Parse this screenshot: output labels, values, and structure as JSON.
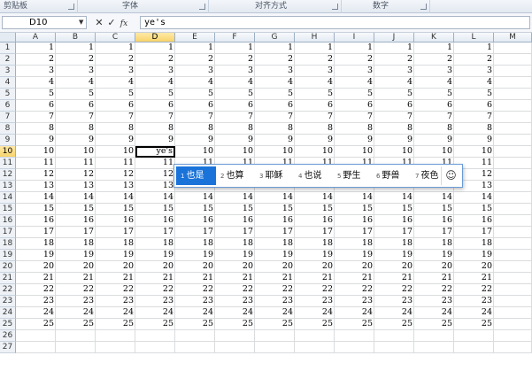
{
  "ribbon": {
    "groups": [
      {
        "label": "剪贴板"
      },
      {
        "label": "字体"
      },
      {
        "label": "对齐方式"
      },
      {
        "label": "数字"
      }
    ]
  },
  "formula_bar": {
    "name_box": "D10",
    "cancel_icon": "cancel-icon",
    "enter_icon": "check-icon",
    "function_icon": "fx-icon",
    "fx_label": "fx",
    "value": "ye's"
  },
  "grid": {
    "columns": [
      "A",
      "B",
      "C",
      "D",
      "E",
      "F",
      "G",
      "H",
      "I",
      "J",
      "K",
      "L",
      "M"
    ],
    "selected_column": "D",
    "rows": [
      "1",
      "2",
      "3",
      "4",
      "5",
      "6",
      "7",
      "8",
      "9",
      "10",
      "11",
      "12",
      "13",
      "14",
      "15",
      "16",
      "17",
      "18",
      "19",
      "20",
      "21",
      "22",
      "23",
      "24",
      "25",
      "26",
      "27"
    ],
    "selected_row": "10",
    "active_cell": {
      "column": "D",
      "row": "10",
      "value": "ye's"
    },
    "row_values": [
      "1",
      "2",
      "3",
      "4",
      "5",
      "6",
      "7",
      "8",
      "9",
      "10",
      "11",
      "12",
      "13",
      "14",
      "15",
      "16",
      "17",
      "18",
      "19",
      "20",
      "21",
      "22",
      "23",
      "24",
      "25"
    ]
  },
  "ime": {
    "candidates": [
      {
        "num": "1",
        "text": "也是"
      },
      {
        "num": "2",
        "text": "也算"
      },
      {
        "num": "3",
        "text": "耶稣"
      },
      {
        "num": "4",
        "text": "也说"
      },
      {
        "num": "5",
        "text": "野生"
      },
      {
        "num": "6",
        "text": "野兽"
      },
      {
        "num": "7",
        "text": "夜色"
      }
    ],
    "emoji_icon": "smiley-icon",
    "emoji_glyph": "☺"
  },
  "colors": {
    "selected_header": "#f7d36a",
    "ime_highlight": "#1a73d9",
    "gridline": "#dadcdd"
  }
}
